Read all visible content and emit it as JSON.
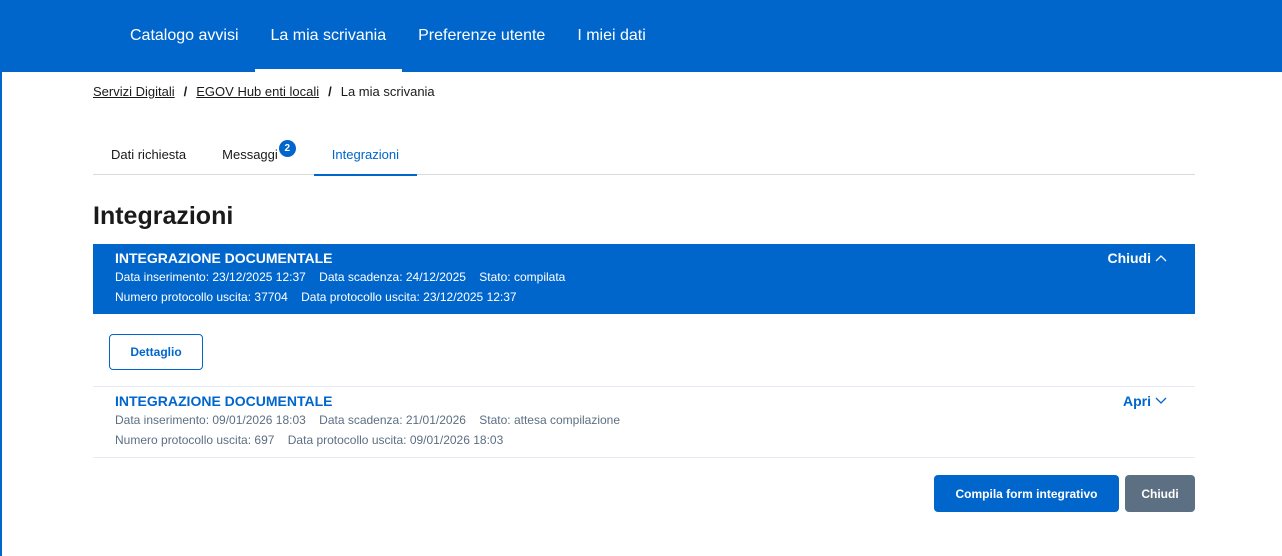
{
  "nav": {
    "items": [
      {
        "label": "Catalogo avvisi"
      },
      {
        "label": "La mia scrivania",
        "active": true
      },
      {
        "label": "Preferenze utente"
      },
      {
        "label": "I miei dati"
      }
    ]
  },
  "breadcrumb": {
    "items": [
      "Servizi Digitali",
      "EGOV Hub enti locali"
    ],
    "current": "La mia scrivania",
    "separator": "/"
  },
  "tabs": {
    "items": [
      {
        "label": "Dati richiesta"
      },
      {
        "label": "Messaggi",
        "badge": "2"
      },
      {
        "label": "Integrazioni",
        "active": true
      }
    ]
  },
  "page_title": "Integrazioni",
  "integrations": [
    {
      "title": "INTEGRAZIONE DOCUMENTALE",
      "data_inserimento": "Data inserimento: 23/12/2025 12:37",
      "data_scadenza": "Data scadenza: 24/12/2025",
      "stato": "Stato: compilata",
      "numero_protocollo": "Numero protocollo uscita: 37704",
      "data_protocollo": "Data protocollo uscita: 23/12/2025 12:37",
      "toggle_label": "Chiudi",
      "toggle_icon": "chevron-up-icon",
      "expanded": true,
      "detail_button": "Dettaglio"
    },
    {
      "title": "INTEGRAZIONE DOCUMENTALE",
      "data_inserimento": "Data inserimento: 09/01/2026 18:03",
      "data_scadenza": "Data scadenza: 21/01/2026",
      "stato": "Stato: attesa compilazione",
      "numero_protocollo": "Numero protocollo uscita: 697",
      "data_protocollo": "Data protocollo uscita: 09/01/2026 18:03",
      "toggle_label": "Apri",
      "toggle_icon": "chevron-down-icon",
      "expanded": false
    }
  ],
  "actions": {
    "primary": "Compila form integrativo",
    "secondary": "Chiudi"
  },
  "colors": {
    "primary": "#0066cc",
    "secondary": "#5d7083",
    "muted_text": "#5c6f82"
  }
}
